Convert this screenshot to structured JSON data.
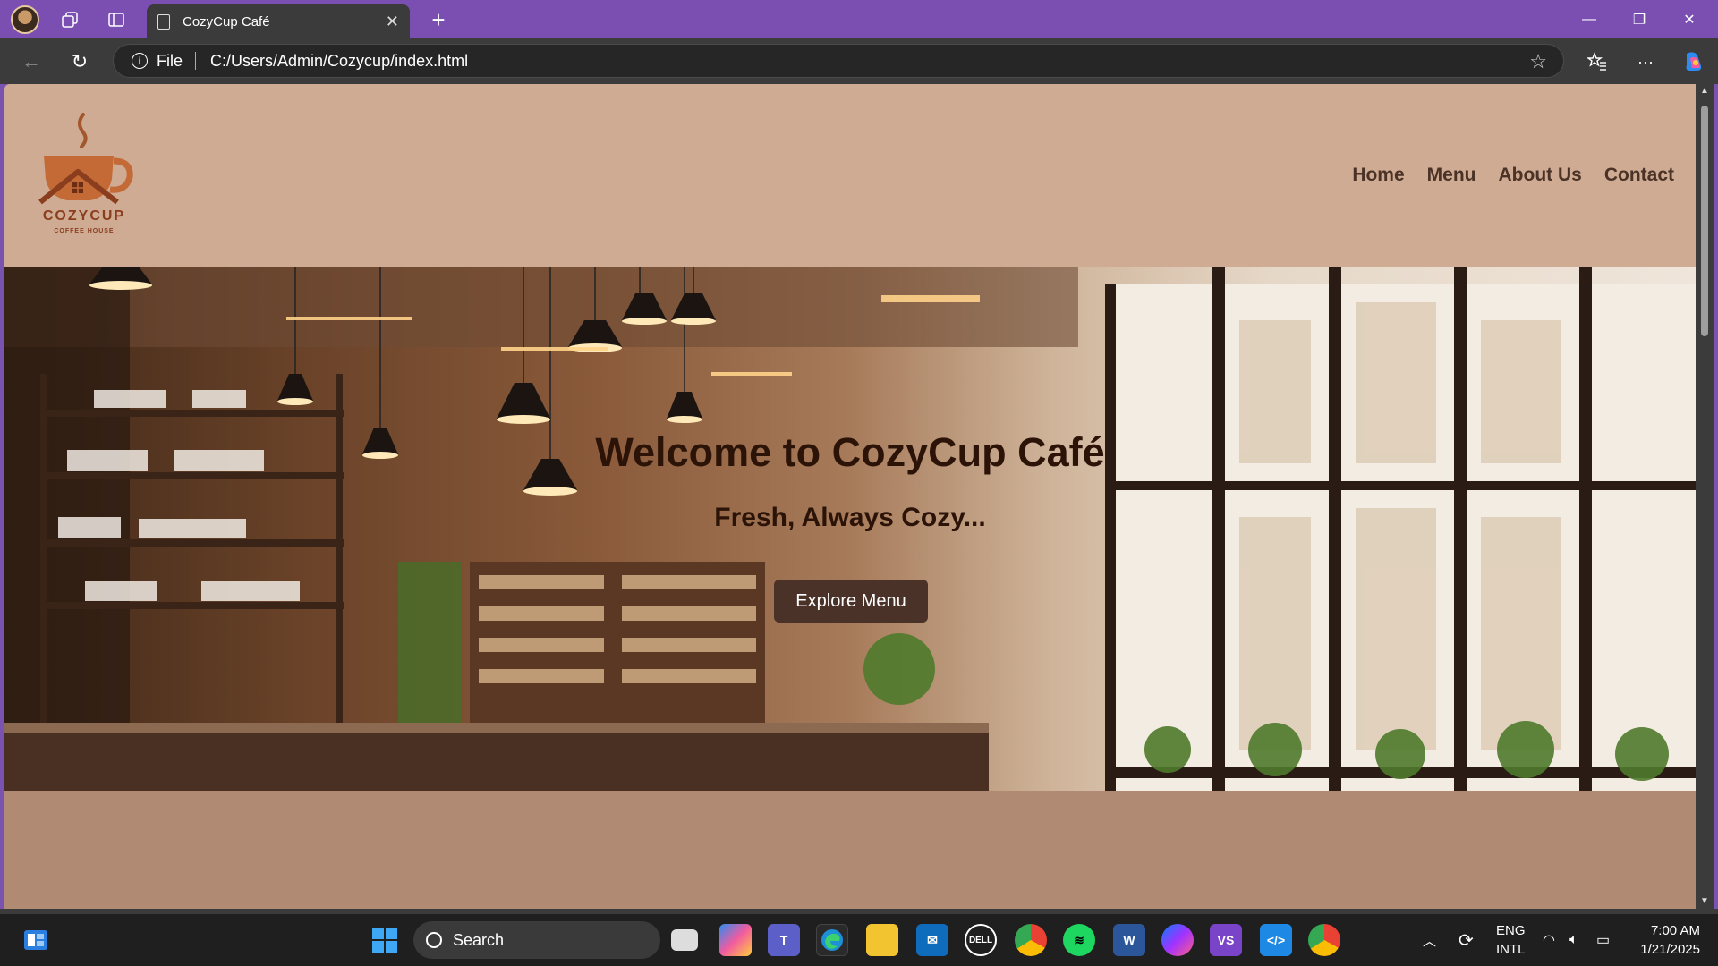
{
  "browser": {
    "tab_title": "CozyCup Café",
    "address_scheme": "File",
    "address_url": "C:/Users/Admin/Cozycup/index.html"
  },
  "site": {
    "logo_name": "COZYCUP",
    "logo_sub": "COFFEE HOUSE",
    "nav": [
      "Home",
      "Menu",
      "About Us",
      "Contact"
    ],
    "hero_title": "Welcome to CozyCup Café",
    "hero_subtitle": "Fresh, Always Cozy...",
    "hero_button": "Explore Menu"
  },
  "taskbar": {
    "search_label": "Search",
    "lang_line1": "ENG",
    "lang_line2": "INTL",
    "time": "7:00 AM",
    "date": "1/21/2025"
  },
  "colors": {
    "titlebar": "#7b4fb2",
    "header_bg": "#cfab93",
    "page_bg": "#b08a72",
    "button_bg": "#4a3228"
  }
}
